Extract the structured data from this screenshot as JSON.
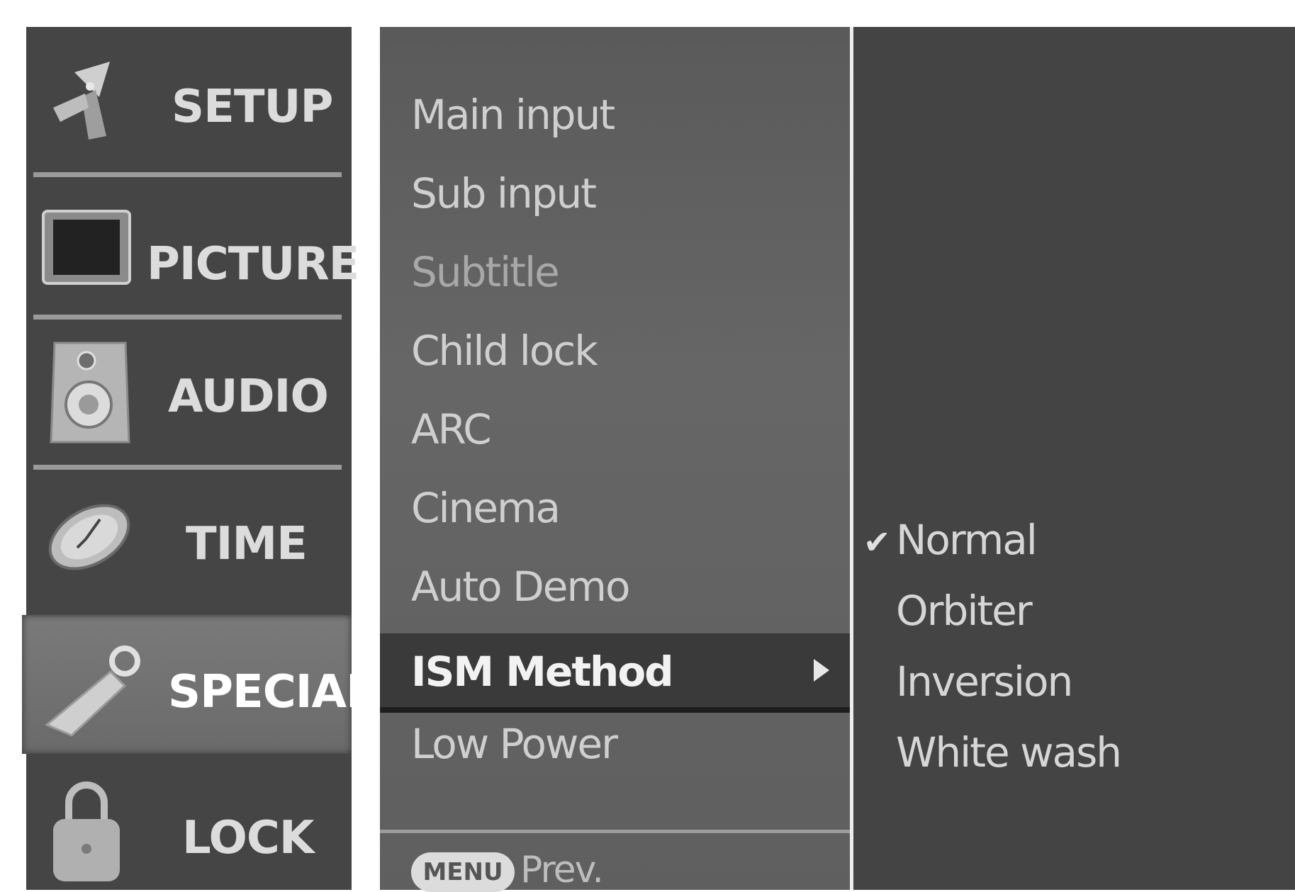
{
  "sidebar": {
    "items": [
      {
        "label": "SETUP",
        "icon": "satellite-icon"
      },
      {
        "label": "PICTURE",
        "icon": "monitor-icon"
      },
      {
        "label": "AUDIO",
        "icon": "speaker-icon"
      },
      {
        "label": "TIME",
        "icon": "clock-icon"
      },
      {
        "label": "SPECIAL",
        "icon": "key-tag-icon",
        "active": true
      },
      {
        "label": "LOCK",
        "icon": "padlock-icon"
      }
    ]
  },
  "menu": {
    "items": [
      {
        "label": "Main input"
      },
      {
        "label": "Sub input"
      },
      {
        "label": "Subtitle",
        "disabled": true
      },
      {
        "label": "Child lock"
      },
      {
        "label": "ARC"
      },
      {
        "label": "Cinema"
      },
      {
        "label": "Auto Demo"
      },
      {
        "label": "ISM Method",
        "selected": true
      },
      {
        "label": "Low Power"
      }
    ],
    "footer": {
      "button": "MENU",
      "label": "Prev."
    }
  },
  "submenu": {
    "options": [
      {
        "label": "Normal",
        "checked": true
      },
      {
        "label": "Orbiter"
      },
      {
        "label": "Inversion"
      },
      {
        "label": "White wash"
      }
    ]
  },
  "colors": {
    "sidebar_bg": "#454545",
    "menu_bg": "#606060",
    "selection_bg": "#3a3a3a",
    "submenu_bg": "#444444"
  }
}
